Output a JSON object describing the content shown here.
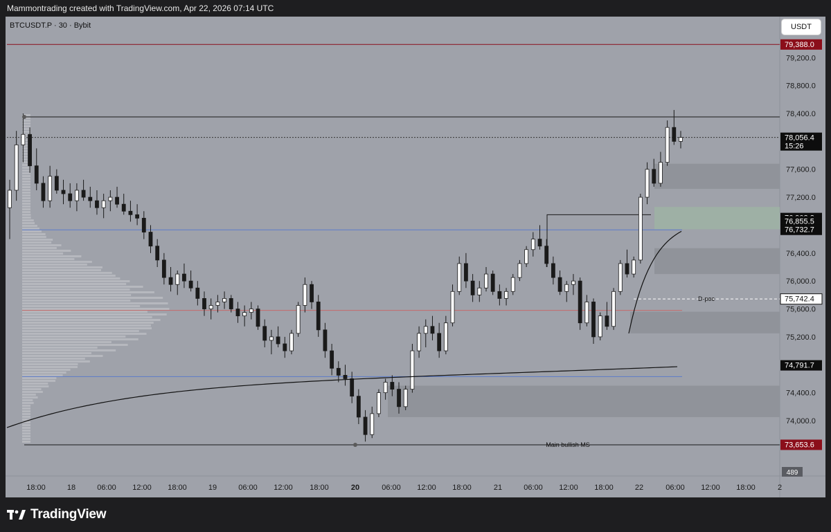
{
  "header": {
    "credit": "Mammontrading created with TradingView.com, Apr 22, 2026 07:14 UTC"
  },
  "symbol_label": "BTCUSDT.P · 30 · Bybit",
  "currency_button": "USDT",
  "footer": {
    "logo_text": "TradingView"
  },
  "colors": {
    "chart_bg": "#9fa2aa",
    "candle_up": "#ffffff",
    "candle_down": "#1a1a1a",
    "red_tag": "#8b0e1a",
    "black_tag": "#0d0d0d",
    "blue_line": "#5b7bc9",
    "red_line": "#c46a6a"
  },
  "chart_data": {
    "type": "candlestick",
    "title": "BTCUSDT.P · 30 · Bybit",
    "ylim": [
      73400,
      79600
    ],
    "y_ticks": [
      "79,200.0",
      "78,800.0",
      "78,400.0",
      "77,600.0",
      "77,200.0",
      "76,400.0",
      "76,000.0",
      "75,600.0",
      "75,200.0",
      "74,400.0",
      "74,000.0"
    ],
    "x_ticks": [
      "18:00",
      "18",
      "06:00",
      "12:00",
      "18:00",
      "19",
      "06:00",
      "12:00",
      "18:00",
      "20",
      "06:00",
      "12:00",
      "18:00",
      "21",
      "06:00",
      "12:00",
      "18:00",
      "22",
      "06:00",
      "12:00",
      "18:00",
      "2"
    ],
    "price_tags": [
      {
        "label": "79,388.0",
        "value": 79388.0,
        "style": "red"
      },
      {
        "label": "78,056.4",
        "value": 78056.4,
        "style": "black",
        "sub": "15:26"
      },
      {
        "label": "76,902.2",
        "value": 76902.2,
        "style": "black"
      },
      {
        "label": "76,855.5",
        "value": 76855.5,
        "style": "black"
      },
      {
        "label": "76,732.7",
        "value": 76732.7,
        "style": "black"
      },
      {
        "label": "75,742.4",
        "value": 75742.4,
        "style": "outline"
      },
      {
        "label": "74,791.7",
        "value": 74791.7,
        "style": "black"
      },
      {
        "label": "73,653.6",
        "value": 73653.6,
        "style": "red"
      }
    ],
    "volume_label": "489",
    "annotations": [
      {
        "text": "D-poc",
        "value": 75742.4
      },
      {
        "text": "Main bullish MS",
        "value": 73653.6
      }
    ],
    "levels": [
      {
        "name": "range-high",
        "value": 78350,
        "color": "#1a1a1a"
      },
      {
        "name": "current-price",
        "value": 78056.4,
        "color": "#333333",
        "dashed": true
      },
      {
        "name": "value-area-high",
        "value": 76732.7,
        "color": "#5b7bc9"
      },
      {
        "name": "volume-poc",
        "value": 75580,
        "color": "#c46a6a"
      },
      {
        "name": "value-area-low",
        "value": 74630,
        "color": "#5b7bc9"
      },
      {
        "name": "range-low",
        "value": 73653.6,
        "color": "#1a1a1a"
      },
      {
        "name": "top-red-level",
        "value": 79388.0,
        "color": "#8b0e1a"
      }
    ],
    "zones": [
      {
        "low": 77320,
        "high": 77680,
        "color": "#8d9098"
      },
      {
        "low": 76740,
        "high": 77060,
        "color": "#9db3a5"
      },
      {
        "low": 76100,
        "high": 76470,
        "color": "#8d9098"
      },
      {
        "low": 75250,
        "high": 75560,
        "color": "#8d9098"
      },
      {
        "low": 74050,
        "high": 74500,
        "color": "#8d9098"
      }
    ],
    "candles_ohlc": [
      [
        77050,
        77450,
        76600,
        77300
      ],
      [
        77300,
        78150,
        77150,
        77950
      ],
      [
        77950,
        78400,
        77700,
        78100
      ],
      [
        78100,
        78200,
        77550,
        77650
      ],
      [
        77650,
        77900,
        77300,
        77400
      ],
      [
        77400,
        77500,
        77050,
        77150
      ],
      [
        77150,
        77650,
        77050,
        77500
      ],
      [
        77500,
        77600,
        77250,
        77300
      ],
      [
        77300,
        77450,
        77100,
        77250
      ],
      [
        77250,
        77400,
        77050,
        77150
      ],
      [
        77150,
        77400,
        77000,
        77300
      ],
      [
        77300,
        77450,
        77150,
        77200
      ],
      [
        77200,
        77350,
        77050,
        77150
      ],
      [
        77150,
        77300,
        76950,
        77050
      ],
      [
        77050,
        77250,
        76900,
        77150
      ],
      [
        77150,
        77300,
        77000,
        77200
      ],
      [
        77200,
        77350,
        77050,
        77100
      ],
      [
        77100,
        77250,
        76950,
        77000
      ],
      [
        77000,
        77150,
        76850,
        76950
      ],
      [
        76950,
        77100,
        76800,
        76900
      ],
      [
        76900,
        77000,
        76600,
        76700
      ],
      [
        76700,
        76800,
        76400,
        76500
      ],
      [
        76500,
        76600,
        76200,
        76300
      ],
      [
        76300,
        76400,
        75950,
        76050
      ],
      [
        76050,
        76200,
        75850,
        75950
      ],
      [
        75950,
        76150,
        75800,
        76100
      ],
      [
        76100,
        76250,
        75900,
        76000
      ],
      [
        76000,
        76150,
        75850,
        75900
      ],
      [
        75900,
        76000,
        75650,
        75750
      ],
      [
        75750,
        75850,
        75500,
        75600
      ],
      [
        75600,
        75750,
        75450,
        75650
      ],
      [
        75650,
        75800,
        75550,
        75700
      ],
      [
        75700,
        75850,
        75600,
        75750
      ],
      [
        75750,
        75800,
        75550,
        75600
      ],
      [
        75600,
        75700,
        75400,
        75500
      ],
      [
        75500,
        75650,
        75350,
        75550
      ],
      [
        75550,
        75700,
        75450,
        75600
      ],
      [
        75600,
        75650,
        75300,
        75350
      ],
      [
        75350,
        75450,
        75050,
        75150
      ],
      [
        75150,
        75300,
        74950,
        75200
      ],
      [
        75200,
        75350,
        75050,
        75100
      ],
      [
        75100,
        75200,
        74900,
        75000
      ],
      [
        75000,
        75300,
        74950,
        75250
      ],
      [
        75250,
        75700,
        75200,
        75650
      ],
      [
        75650,
        76050,
        75550,
        75950
      ],
      [
        75950,
        76000,
        75600,
        75700
      ],
      [
        75700,
        75800,
        75200,
        75300
      ],
      [
        75300,
        75400,
        74900,
        75000
      ],
      [
        75000,
        75100,
        74650,
        74750
      ],
      [
        74750,
        74850,
        74550,
        74650
      ],
      [
        74650,
        74800,
        74500,
        74600
      ],
      [
        74600,
        74700,
        74250,
        74350
      ],
      [
        74350,
        74450,
        73950,
        74050
      ],
      [
        74050,
        74150,
        73700,
        73800
      ],
      [
        73800,
        74200,
        73750,
        74100
      ],
      [
        74100,
        74450,
        74050,
        74400
      ],
      [
        74400,
        74600,
        74300,
        74550
      ],
      [
        74550,
        74650,
        74350,
        74450
      ],
      [
        74450,
        74550,
        74100,
        74200
      ],
      [
        74200,
        74500,
        74150,
        74450
      ],
      [
        74450,
        75100,
        74400,
        75000
      ],
      [
        75000,
        75350,
        74900,
        75250
      ],
      [
        75250,
        75450,
        75050,
        75350
      ],
      [
        75350,
        75500,
        75150,
        75250
      ],
      [
        75250,
        75400,
        74900,
        75000
      ],
      [
        75000,
        75500,
        74950,
        75400
      ],
      [
        75400,
        75950,
        75350,
        75850
      ],
      [
        75850,
        76350,
        75800,
        76250
      ],
      [
        76250,
        76400,
        75900,
        76000
      ],
      [
        76000,
        76100,
        75700,
        75800
      ],
      [
        75800,
        76000,
        75700,
        75900
      ],
      [
        75900,
        76200,
        75850,
        76100
      ],
      [
        76100,
        76150,
        75800,
        75850
      ],
      [
        75850,
        75950,
        75650,
        75750
      ],
      [
        75750,
        75900,
        75650,
        75850
      ],
      [
        75850,
        76100,
        75800,
        76050
      ],
      [
        76050,
        76300,
        76000,
        76250
      ],
      [
        76250,
        76500,
        76200,
        76450
      ],
      [
        76450,
        76700,
        76350,
        76600
      ],
      [
        76600,
        76800,
        76450,
        76500
      ],
      [
        76500,
        76600,
        76200,
        76250
      ],
      [
        76250,
        76350,
        75950,
        76050
      ],
      [
        76050,
        76150,
        75800,
        75850
      ],
      [
        75850,
        76000,
        75700,
        75950
      ],
      [
        75950,
        76100,
        75800,
        76000
      ],
      [
        76000,
        76050,
        75300,
        75400
      ],
      [
        75400,
        75800,
        75350,
        75700
      ],
      [
        75700,
        75750,
        75100,
        75200
      ],
      [
        75200,
        75550,
        75150,
        75500
      ],
      [
        75500,
        75700,
        75300,
        75350
      ],
      [
        75350,
        75900,
        75300,
        75850
      ],
      [
        75850,
        76300,
        75800,
        76250
      ],
      [
        76250,
        76450,
        76050,
        76100
      ],
      [
        76100,
        76350,
        76050,
        76300
      ],
      [
        76300,
        77250,
        76250,
        77200
      ],
      [
        77200,
        77700,
        77100,
        77600
      ],
      [
        77600,
        77750,
        77350,
        77400
      ],
      [
        77400,
        77850,
        77350,
        77700
      ],
      [
        77700,
        78300,
        77650,
        78200
      ],
      [
        78200,
        78450,
        77950,
        78000
      ],
      [
        78000,
        78150,
        77900,
        78056.4
      ]
    ]
  }
}
